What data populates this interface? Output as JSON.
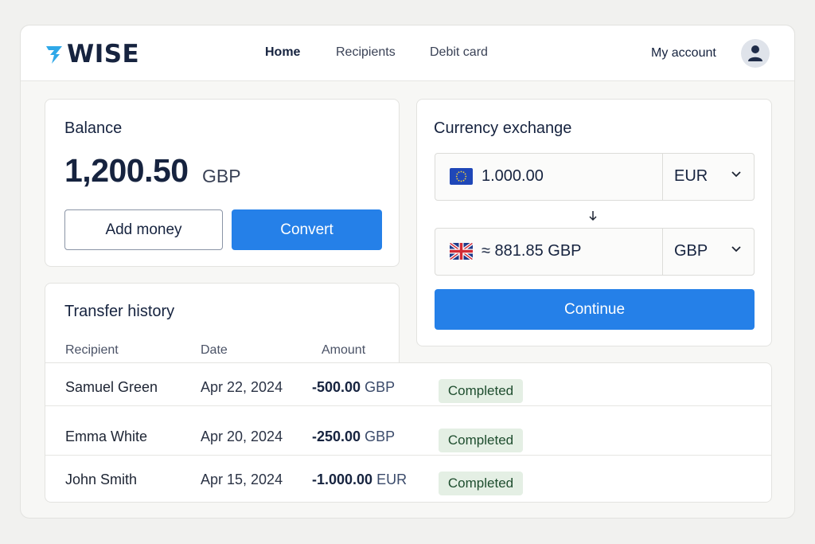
{
  "app": {
    "logo_text": "WISE",
    "brand_color": "#16233f",
    "accent_color": "#2580e8",
    "logo_icon": "wise-flag-icon"
  },
  "nav": {
    "items": [
      {
        "label": "Home",
        "active": true
      },
      {
        "label": "Recipients",
        "active": false
      },
      {
        "label": "Debit card",
        "active": false
      }
    ],
    "account_label": "My account",
    "avatar_icon": "user-icon"
  },
  "balance": {
    "title": "Balance",
    "amount": "1,200.50",
    "currency": "GBP",
    "add_money_label": "Add money",
    "convert_label": "Convert"
  },
  "exchange": {
    "title": "Currency exchange",
    "from": {
      "value": "1.000.00",
      "currency": "EUR",
      "flag_icon": "eu-flag-icon"
    },
    "to": {
      "value": "≈ 881.85 GBP",
      "currency": "GBP",
      "flag_icon": "uk-flag-icon"
    },
    "continue_label": "Continue"
  },
  "history": {
    "title": "Transfer history",
    "columns": [
      "Recipient",
      "Date",
      "Amount"
    ],
    "rows": [
      {
        "recipient": "Samuel Green",
        "date": "Apr 22, 2024",
        "amount": "-500.00",
        "currency": "GBP",
        "status": "Completed"
      },
      {
        "recipient": "Emma White",
        "date": "Apr 20, 2024",
        "amount": "-250.00",
        "currency": "GBP",
        "status": "Completed"
      },
      {
        "recipient": "John Smith",
        "date": "Apr 15, 2024",
        "amount": "-1.000.00",
        "currency": "EUR",
        "status": "Completed"
      }
    ],
    "status_color": "#e4efe4"
  }
}
